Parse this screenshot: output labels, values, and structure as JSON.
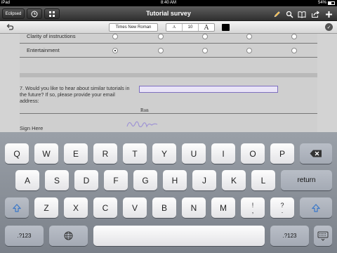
{
  "status_bar": {
    "device": "iPad",
    "time": "8:40 AM",
    "battery": "54%"
  },
  "navbar": {
    "left_button": "Eclipsed",
    "title": "Tutorial survey",
    "icons": [
      "pencil-icon",
      "search-icon",
      "book-icon",
      "share-icon",
      "add-icon"
    ]
  },
  "format_bar": {
    "font_name": "Times New Roman",
    "small_a": "A",
    "font_size": "10",
    "large_a": "A",
    "color": "#000000"
  },
  "document": {
    "rows": [
      {
        "label": "Clarity of instructions",
        "selected": -1
      },
      {
        "label": "Entertainment",
        "selected": 0
      }
    ],
    "question7": "7. Would you like to hear about similar tutorials in the future? If so, please provide your email address:",
    "email_value": "",
    "signer_name": "Ron",
    "sign_label": "Sign Here"
  },
  "keyboard": {
    "row1": [
      "Q",
      "W",
      "E",
      "R",
      "T",
      "Y",
      "U",
      "I",
      "O",
      "P"
    ],
    "row2": [
      "A",
      "S",
      "D",
      "F",
      "G",
      "H",
      "J",
      "K",
      "L"
    ],
    "row3": [
      "Z",
      "X",
      "C",
      "V",
      "B",
      "N",
      "M"
    ],
    "punct1_top": "!",
    "punct1_bottom": ",",
    "punct2_top": "?",
    "punct2_bottom": ".",
    "return_label": "return",
    "numbers_label": ".?123",
    "shift_icon": "shift-icon",
    "backspace_icon": "backspace-icon",
    "globe_icon": "globe-icon",
    "hide_keyboard_icon": "keyboard-hide-icon"
  },
  "colors": {
    "navbar": "#3f3f3f",
    "document_bg": "#cfcfcf",
    "field_highlight": "#e9e4f7",
    "shift_blue": "#3a78c9"
  }
}
